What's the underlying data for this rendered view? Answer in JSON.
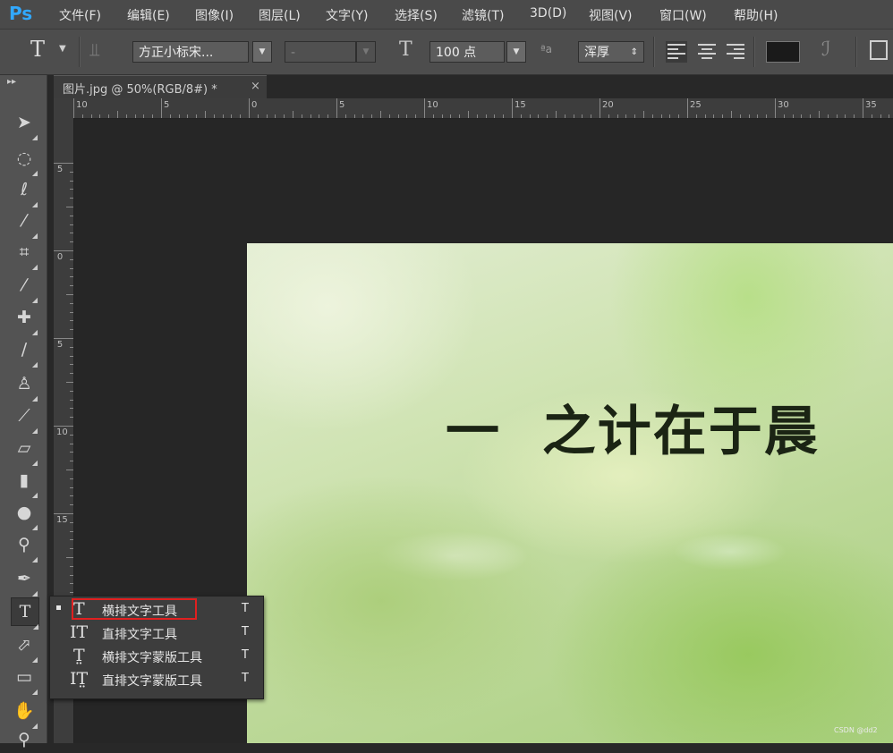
{
  "app": {
    "logo": "Ps"
  },
  "menubar": {
    "items": [
      "文件(F)",
      "编辑(E)",
      "图像(I)",
      "图层(L)",
      "文字(Y)",
      "选择(S)",
      "滤镜(T)",
      "3D(D)",
      "视图(V)",
      "窗口(W)",
      "帮助(H)"
    ]
  },
  "options": {
    "tool_glyph": "T",
    "font_family": "方正小标宋...",
    "font_style": "-",
    "font_size": "100 点",
    "antialias": "浑厚",
    "aa_label": "ªa",
    "text_color": "#1a1a1a"
  },
  "document": {
    "tab_title": "图片.jpg @ 50%(RGB/8#) *",
    "close": "×"
  },
  "rulers": {
    "horizontal": [
      "10",
      "5",
      "0",
      "5",
      "10",
      "15",
      "20",
      "25",
      "30",
      "35"
    ],
    "vertical": [
      "5",
      "0",
      "5",
      "10",
      "15",
      "5"
    ]
  },
  "canvas": {
    "text": "一  之计在于晨"
  },
  "flyout": {
    "items": [
      {
        "icon": "T",
        "label": "横排文字工具",
        "key": "T",
        "selected": true
      },
      {
        "icon": "IT",
        "label": "直排文字工具",
        "key": "T",
        "selected": false
      },
      {
        "icon": "T̤",
        "label": "横排文字蒙版工具",
        "key": "T",
        "selected": false
      },
      {
        "icon": "IT̤",
        "label": "直排文字蒙版工具",
        "key": "T",
        "selected": false
      }
    ]
  },
  "watermark": "CSDN @dd2"
}
